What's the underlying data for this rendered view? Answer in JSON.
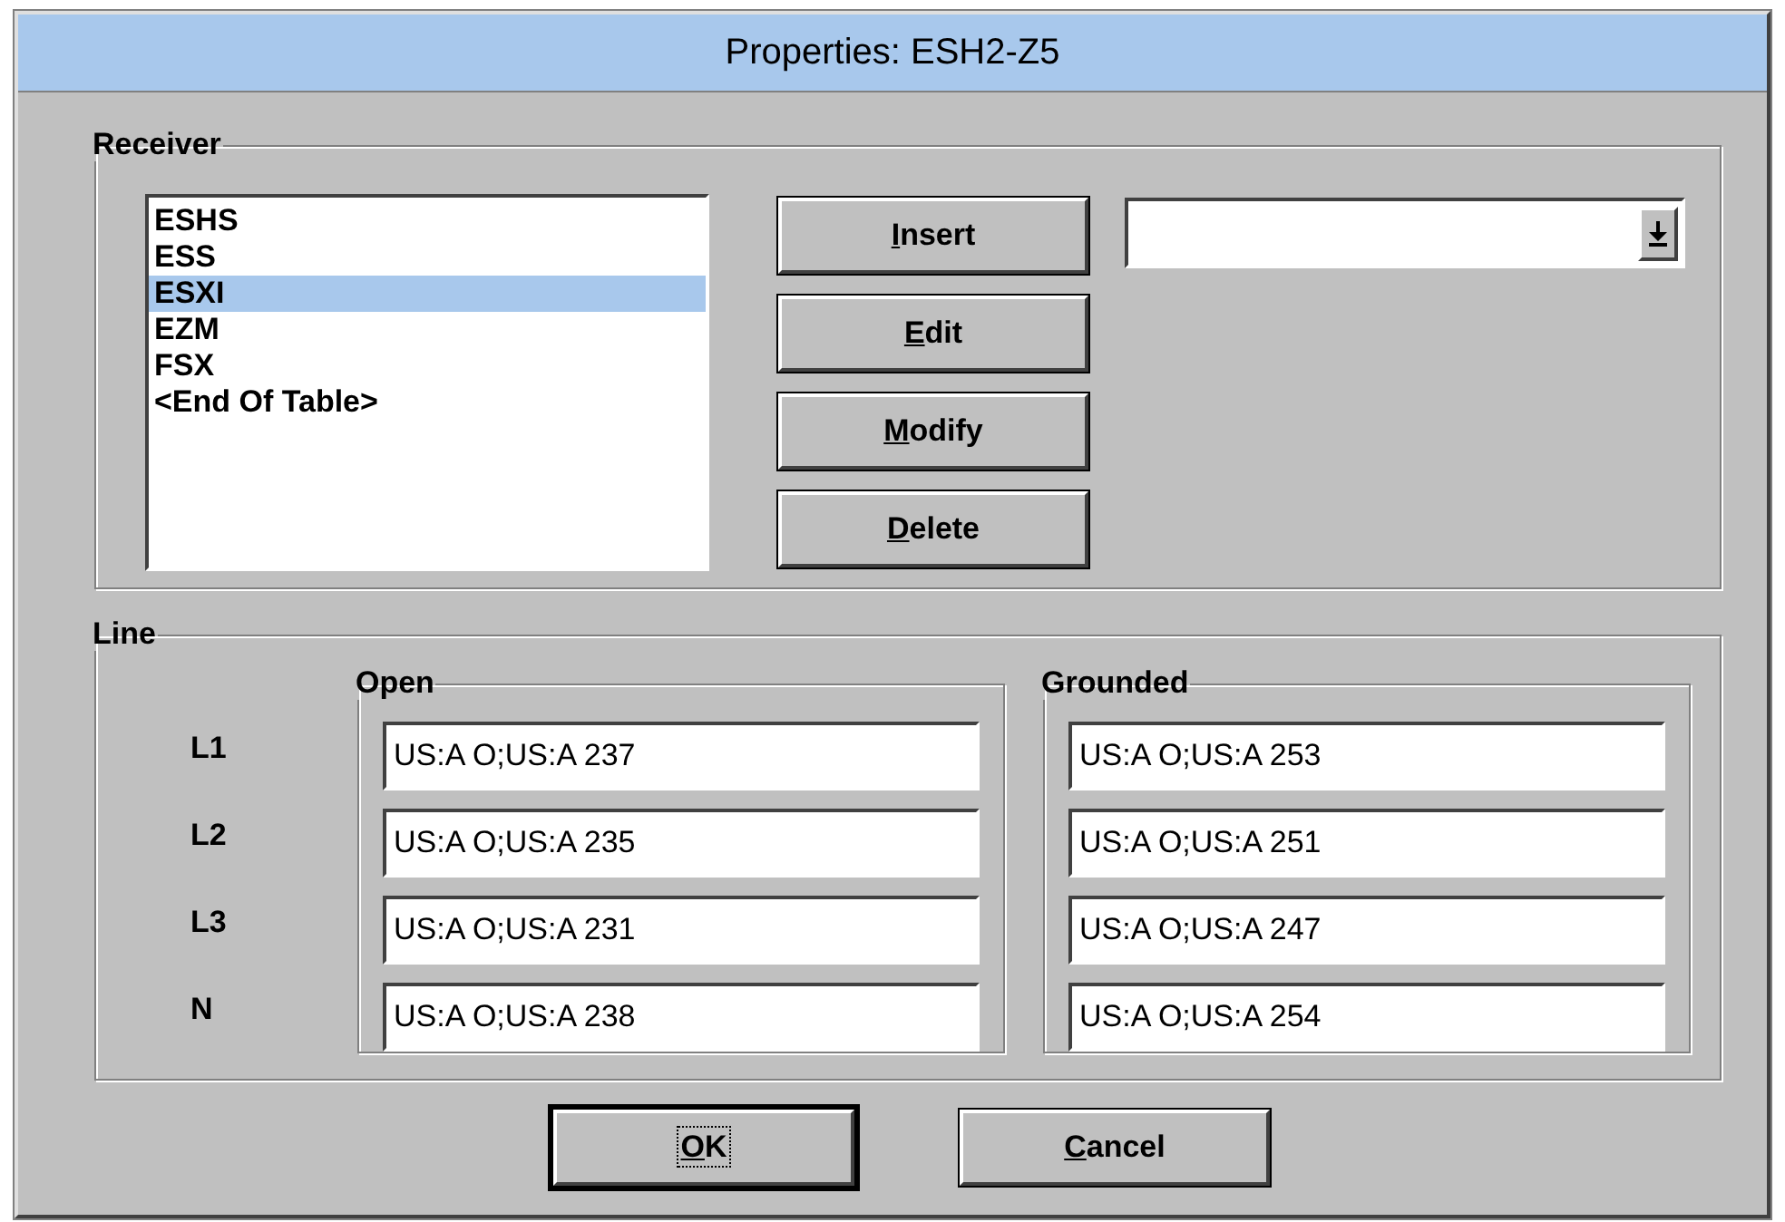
{
  "window": {
    "title": "Properties: ESH2-Z5"
  },
  "receiver": {
    "label": "Receiver",
    "list": [
      {
        "text": "ESHS",
        "selected": false
      },
      {
        "text": "ESS",
        "selected": false
      },
      {
        "text": "ESXI",
        "selected": true
      },
      {
        "text": "EZM",
        "selected": false
      },
      {
        "text": "FSX",
        "selected": false
      },
      {
        "text": "<End Of Table>",
        "selected": false
      }
    ],
    "buttons": [
      {
        "label": "Insert",
        "first_letter_underlined": true
      },
      {
        "label": "Edit",
        "first_letter_underlined": true
      },
      {
        "label": "Modify",
        "first_letter_underlined": true
      },
      {
        "label": "Delete",
        "first_letter_underlined": true
      }
    ]
  },
  "line": {
    "label": "Line",
    "row_labels": [
      "L1",
      "L2",
      "L3",
      "N"
    ],
    "groups": [
      {
        "label": "Open",
        "values": [
          "US:A O;US:A 237",
          "US:A O;US:A 235",
          "US:A O;US:A 231",
          "US:A O;US:A 238"
        ]
      },
      {
        "label": "Grounded",
        "values": [
          "US:A O;US:A 253",
          "US:A O;US:A 251",
          "US:A O;US:A 247",
          "US:A O;US:A 254"
        ]
      }
    ]
  },
  "buttons": [
    {
      "label": "OK",
      "first_letter_underlined": true,
      "default": true
    },
    {
      "label": "Cancel",
      "first_letter_underlined": true,
      "default": false
    }
  ]
}
